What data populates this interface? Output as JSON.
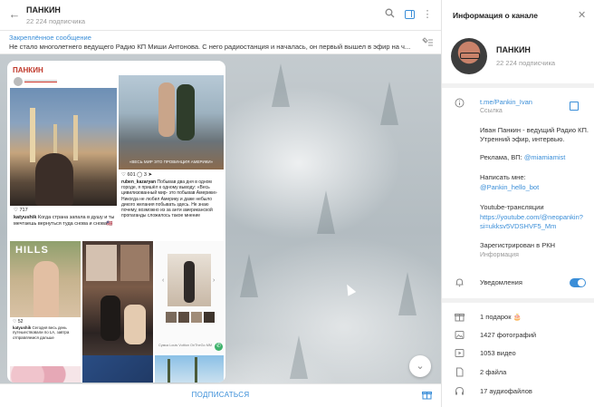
{
  "header": {
    "title": "ПАНКИН",
    "subscribers": "22 224 подписчика"
  },
  "pinned": {
    "label": "Закреплённое сообщение",
    "text": "Не стало многолетнего ведущего Радио КП Миши Антонова. С него радиостанция и началась, он первый вышел в эфир на ч..."
  },
  "post": {
    "author": "ПАНКИН",
    "insta": {
      "likes1": "♡ 717",
      "user1": "katyushik",
      "cap1": "Когда страна запала в душу и ты мечтаешь вернуться туда снова и снова🇺🇸",
      "likes2": "♡ 601",
      "comments2": "3",
      "user2": "ruben_kazaryan",
      "cap2": "Побывав два дня в одном городе, я пришёл к одному выводу: «Весь цивилизованный мир- это побывав Америки» Никогда не любил Америку и даже небыло дикого желания побывать здесь. Не знаю почему, возможно из за анти американской пропаганды сложилось такое мнение",
      "overlay_text": "«ВЕСЬ МИР ЭТО ПРОВИНЦИЯ АМЕРИКИ»",
      "user3": "katyushik",
      "cap3": "Сегодня весь день путешествовали по LA, завтра отправляемся дальше",
      "likes3": "♡ 52",
      "caption_shop": "Сумка Louis Vuitton OnTheGo MM"
    }
  },
  "footer": {
    "subscribe": "ПОДПИСАТЬСЯ"
  },
  "info": {
    "title": "Информация о канале",
    "name": "ПАНКИН",
    "subscribers": "22 224 подписчика",
    "link": "t.me/Pankin_Ivan",
    "link_label": "Ссылка",
    "desc": "Иван Панкин - ведущий Радио КП. Утренний эфир, интервью.",
    "ads_prefix": "Реклама, ВП: ",
    "ads_handle": "@miamiamist",
    "write_label": "Написать мне:",
    "write_handle": "@Pankin_hello_bot",
    "yt_label": "Youtube-трансляции",
    "yt_link": "https://youtube.com/@neopankin?si=ukksv5VDSHVF5_Mm",
    "rkn": "Зарегистрирован в РКН",
    "rkn_label": "Информация",
    "notifications": "Уведомления",
    "gifts": "1 подарок 🎂",
    "photos": "1427 фотографий",
    "videos": "1053 видео",
    "files": "2 файла",
    "audio": "17 аудиофайлов"
  },
  "colors": {
    "accent": "#3a8ed8",
    "post_author": "#c0392b"
  }
}
